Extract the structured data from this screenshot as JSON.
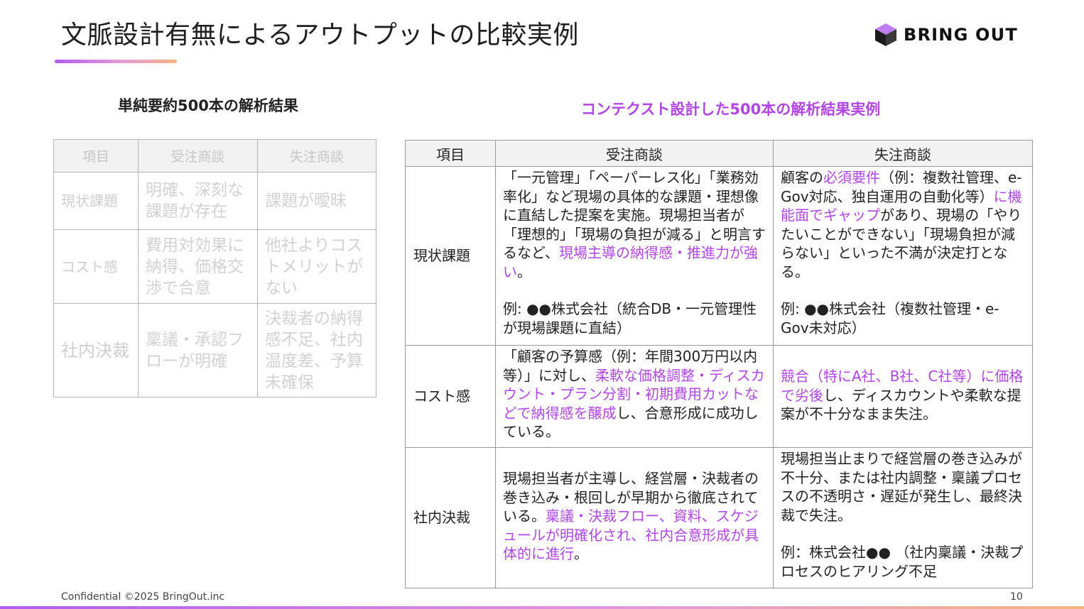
{
  "slide": {
    "title": "文脈設計有無によるアウトプットの比較実例",
    "logo_text": "BRING OUT",
    "footer": "Confidential ©2025 BringOut.inc",
    "page_number": "10",
    "colors": {
      "accent": "#b146e6",
      "gradient_start": "#b05cf0",
      "gradient_end": "#f5b57f"
    }
  },
  "left": {
    "heading": "単純要約500本の解析結果",
    "headers": [
      "項目",
      "受注商談",
      "失注商談"
    ],
    "rows": [
      {
        "label": "現状課題",
        "won": "明確、深刻な課題が存在",
        "lost": "課題が曖昧"
      },
      {
        "label": "コスト感",
        "won": "費用対効果に納得、価格交渉で合意",
        "lost": "他社よりコストメリットがない"
      },
      {
        "label": "社内決裁",
        "won": "稟議・承認フローが明確",
        "lost": "決裁者の納得感不足、社内温度差、予算未確保"
      }
    ]
  },
  "right": {
    "heading": "コンテクスト設計した500本の解析結果実例",
    "headers": [
      "項目",
      "受注商談",
      "失注商談"
    ],
    "rows": [
      {
        "label": "現状課題",
        "won": {
          "t1": "「一元管理」「ペーパーレス化」「業務効率化」など現場の具体的な課題・理想像に直結した提案を実施。現場担当者が「理想的」「現場の負担が減る」と明言するなど、",
          "h1": "現場主導の納得感・推進力が強い",
          "t2": "。",
          "example": "例: ●●株式会社（統合DB・一元管理性が現場課題に直結）"
        },
        "lost": {
          "t1": "顧客の",
          "h1": "必須要件",
          "t2": "（例：複数社管理、e-Gov対応、独自運用の自動化等）",
          "h2": "に機能面でギャップ",
          "t3": "があり、現場の「やりたいことができない」「現場負担が減らない」といった不満が決定打となる。",
          "example": "例: ●●株式会社（複数社管理・e-Gov未対応）"
        }
      },
      {
        "label": "コスト感",
        "won": {
          "t1": "「顧客の予算感（例：年間300万円以内等）」に対し、",
          "h1": "柔軟な価格調整・ディスカウント・プラン分割・初期費用カットなどで納得感を醸成",
          "t2": "し、合意形成に成功している。"
        },
        "lost": {
          "h1": "競合（特にA社、B社、C社等）に価格で劣後",
          "t1": "し、ディスカウントや柔軟な提案が不十分なまま失注。"
        }
      },
      {
        "label": "社内決裁",
        "won": {
          "t1": "現場担当者が主導し、経営層・決裁者の巻き込み・根回しが早期から徹底されている。",
          "h1": "稟議・決裁フロー、資料、スケジュールが明確化され、社内合意形成が具体的に進行",
          "t2": "。"
        },
        "lost": {
          "t1": "現場担当止まりで経営層の巻き込みが不十分、または社内調整・稟議プロセスの不透明さ・遅延が発生し、最終決裁で失注。",
          "example": "例：株式会社●● （社内稟議・決裁プロセスのヒアリング不足"
        }
      }
    ]
  }
}
